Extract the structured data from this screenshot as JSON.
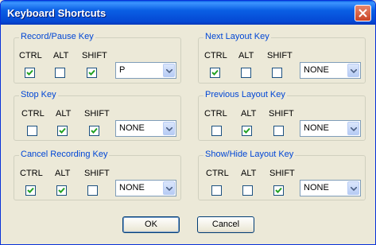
{
  "window": {
    "title": "Keyboard Shortcuts"
  },
  "labels": {
    "ctrl": "CTRL",
    "alt": "ALT",
    "shift": "SHIFT"
  },
  "groups": [
    {
      "title": "Record/Pause Key",
      "ctrl": true,
      "alt": false,
      "shift": true,
      "key": "P"
    },
    {
      "title": "Stop Key",
      "ctrl": false,
      "alt": true,
      "shift": true,
      "key": "NONE"
    },
    {
      "title": "Cancel Recording Key",
      "ctrl": true,
      "alt": true,
      "shift": false,
      "key": "NONE"
    },
    {
      "title": "Next Layout Key",
      "ctrl": true,
      "alt": false,
      "shift": false,
      "key": "NONE"
    },
    {
      "title": "Previous Layout Key",
      "ctrl": false,
      "alt": true,
      "shift": false,
      "key": "NONE"
    },
    {
      "title": "Show/Hide Layout Key",
      "ctrl": false,
      "alt": false,
      "shift": true,
      "key": "NONE"
    }
  ],
  "buttons": {
    "ok": "OK",
    "cancel": "Cancel"
  },
  "colors": {
    "titlebar": "#0a5fe4",
    "legend": "#0046d5",
    "check": "#21a121"
  }
}
